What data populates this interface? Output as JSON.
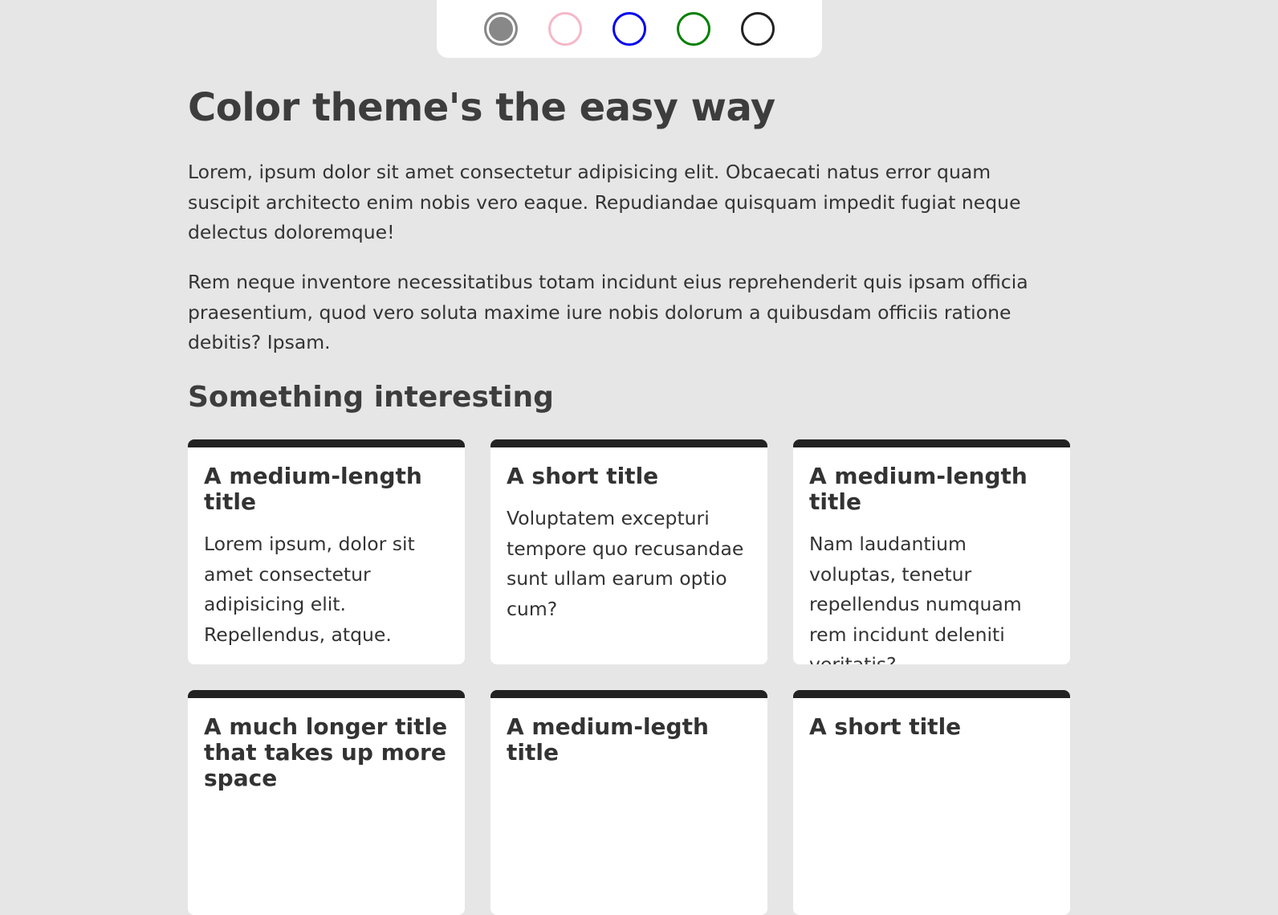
{
  "theme_picker": {
    "swatches": [
      {
        "name": "gray",
        "color": "#888888",
        "active": true
      },
      {
        "name": "pink",
        "color": "#f5b8c8",
        "active": false
      },
      {
        "name": "blue",
        "color": "#0000ee",
        "active": false
      },
      {
        "name": "green",
        "color": "#008000",
        "active": false
      },
      {
        "name": "dark",
        "color": "#222222",
        "active": false
      }
    ]
  },
  "main": {
    "title": "Color theme's the easy way",
    "paragraphs": [
      "Lorem, ipsum dolor sit amet consectetur adipisicing elit. Obcaecati natus error quam suscipit architecto enim nobis vero eaque. Repudiandae quisquam impedit fugiat neque delectus doloremque!",
      "Rem neque inventore necessitatibus totam incidunt eius reprehenderit quis ipsam officia praesentium, quod vero soluta maxime iure nobis dolorum a quibusdam officiis ratione debitis? Ipsam."
    ],
    "section_title": "Something interesting",
    "cards": [
      {
        "title": "A medium-length title",
        "body": "Lorem ipsum, dolor sit amet consectetur adipisicing elit. Repellendus, atque."
      },
      {
        "title": "A short title",
        "body": "Voluptatem excepturi tempore quo recusandae sunt ullam earum optio cum?"
      },
      {
        "title": "A medium-length title",
        "body": "Nam laudantium voluptas, tenetur repellendus numquam rem incidunt deleniti veritatis?"
      },
      {
        "title": "A much longer title that takes up more space",
        "body": ""
      },
      {
        "title": "A medium-legth title",
        "body": ""
      },
      {
        "title": "A short title",
        "body": ""
      }
    ]
  },
  "colors": {
    "background": "#e6e6e6",
    "surface": "#ffffff",
    "accent": "#222222",
    "text": "#333333"
  }
}
